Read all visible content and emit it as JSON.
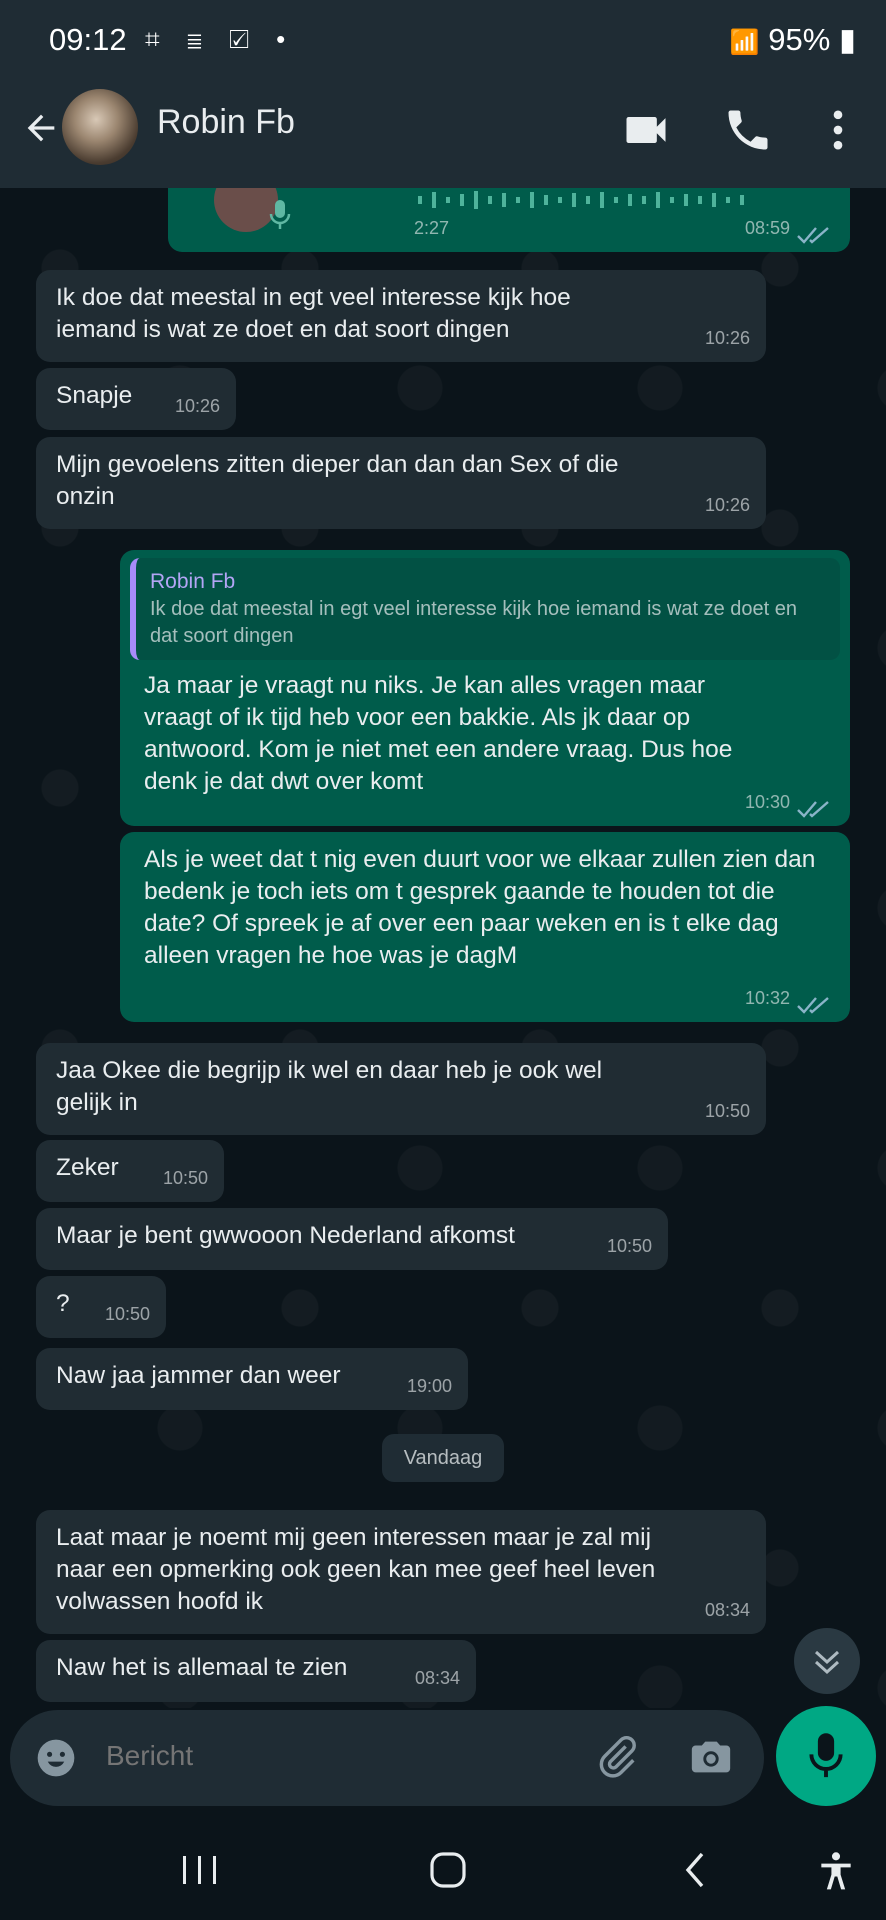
{
  "status_bar": {
    "time": "09:12",
    "battery": "95%"
  },
  "header": {
    "contact_name": "Robin Fb"
  },
  "voice_note": {
    "duration": "2:27",
    "time": "08:59"
  },
  "messages": [
    {
      "dir": "in",
      "text": "Ik doe dat meestal in egt veel interesse kijk hoe iemand is wat ze doet en dat soort dingen",
      "time": "10:26"
    },
    {
      "dir": "in",
      "text": "Snapje",
      "time": "10:26"
    },
    {
      "dir": "in",
      "text": "Mijn gevoelens zitten dieper dan dan dan Sex of die onzin",
      "time": "10:26"
    },
    {
      "dir": "out",
      "quote_name": "Robin Fb",
      "quote_text": "Ik doe dat meestal in egt veel interesse kijk hoe iemand is wat ze doet en dat soort dingen",
      "text": "Ja maar je vraagt nu niks. Je kan alles vragen maar vraagt of ik tijd heb voor een bakkie. Als jk daar op antwoord.  Kom je niet met een andere vraag. Dus hoe denk je dat dwt over komt",
      "time": "10:30"
    },
    {
      "dir": "out",
      "text": "Als je weet dat t nig even duurt voor we elkaar zullen zien dan bedenk je toch iets om t gesprek gaande te houden tot die date? Of spreek je af over een paar weken en is t elke dag alleen vragen he hoe was je dagM",
      "time": "10:32"
    },
    {
      "dir": "in",
      "text": "Jaa Okee die begrijp ik wel en daar heb je ook wel gelijk in",
      "time": "10:50"
    },
    {
      "dir": "in",
      "text": "Zeker",
      "time": "10:50"
    },
    {
      "dir": "in",
      "text": "Maar je bent gwwooon Nederland afkomst",
      "time": "10:50"
    },
    {
      "dir": "in",
      "text": "?",
      "time": "10:50"
    },
    {
      "dir": "in",
      "text": "Naw jaa jammer dan weer",
      "time": "19:00"
    },
    {
      "dir": "in",
      "text": "Laat maar je noemt mij geen interessen maar je zal mij naar een opmerking ook geen kan mee geef heel leven volwassen hoofd ik",
      "time": "08:34"
    },
    {
      "dir": "in",
      "text": "Naw het is allemaal te zien",
      "time": "08:34"
    }
  ],
  "day_separator": "Vandaag",
  "composer": {
    "placeholder": "Bericht"
  },
  "icons": {
    "back": "arrow-left-icon",
    "video": "video-call-icon",
    "call": "phone-icon",
    "menu": "more-vert-icon",
    "emoji": "emoji-icon",
    "attach": "paperclip-icon",
    "camera": "camera-icon",
    "mic": "mic-icon"
  },
  "colors": {
    "accent": "#00a884",
    "outgoing_bubble": "#005c4b",
    "incoming_bubble": "#202c33",
    "header": "#1f2c34",
    "read_ticks": "#8ab4c8"
  }
}
